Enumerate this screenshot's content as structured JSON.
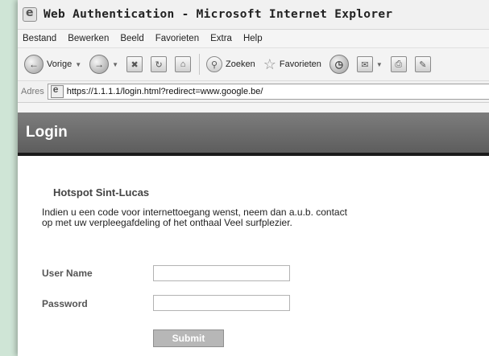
{
  "window": {
    "title": "Web Authentication - Microsoft Internet Explorer",
    "menu": [
      "Bestand",
      "Bewerken",
      "Beeld",
      "Favorieten",
      "Extra",
      "Help"
    ],
    "toolbar": {
      "back_label": "Vorige",
      "search_label": "Zoeken",
      "favorites_label": "Favorieten"
    },
    "address": {
      "label": "Adres",
      "url": "https://1.1.1.1/login.html?redirect=www.google.be/"
    }
  },
  "page": {
    "band_title": "Login",
    "heading": "Hotspot Sint-Lucas",
    "message": "Indien u een code voor internettoegang wenst, neem dan a.u.b. contact op met uw verpleegafdeling of het onthaal Veel surfplezier.",
    "form": {
      "username_label": "User Name",
      "password_label": "Password",
      "submit_label": "Submit"
    }
  }
}
